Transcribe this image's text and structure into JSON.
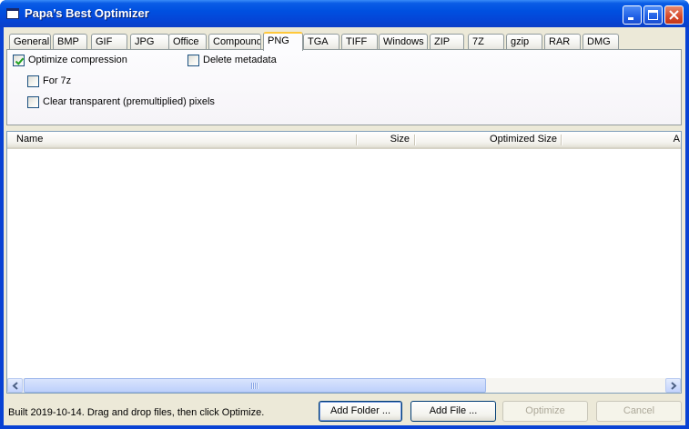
{
  "window": {
    "title": "Papa’s Best Optimizer",
    "icon": "app-window-icon",
    "controls": [
      "minimize-icon",
      "maximize-icon",
      "close-icon"
    ]
  },
  "tabs": [
    {
      "label": "General"
    },
    {
      "label": "BMP"
    },
    {
      "label": "GIF"
    },
    {
      "label": "JPG"
    },
    {
      "label": "Office"
    },
    {
      "label": "Compound"
    },
    {
      "label": "PNG",
      "active": true
    },
    {
      "label": "TGA"
    },
    {
      "label": "TIFF"
    },
    {
      "label": "Windows"
    },
    {
      "label": "ZIP"
    },
    {
      "label": "7Z"
    },
    {
      "label": "gzip"
    },
    {
      "label": "RAR"
    },
    {
      "label": "DMG"
    }
  ],
  "png_options": {
    "optimize_compression": {
      "label": "Optimize compression",
      "checked": true
    },
    "delete_metadata": {
      "label": "Delete metadata",
      "checked": false
    },
    "for_7z": {
      "label": "For 7z",
      "checked": false
    },
    "clear_transparent": {
      "label": "Clear transparent (premultiplied) pixels",
      "checked": false
    }
  },
  "file_list": {
    "columns": [
      "Name",
      "Size",
      "Optimized Size",
      "A"
    ],
    "rows": []
  },
  "status_text": "Built 2019-10-14. Drag and drop files, then click Optimize.",
  "buttons": {
    "add_folder": "Add Folder ...",
    "add_file": "Add File ...",
    "optimize": "Optimize",
    "cancel": "Cancel"
  },
  "colors": {
    "titlebar": "#0050e0",
    "active_tab_accent": "#ffc83c",
    "dialog_face": "#ece9d8",
    "checkbox_check": "#21a121"
  }
}
